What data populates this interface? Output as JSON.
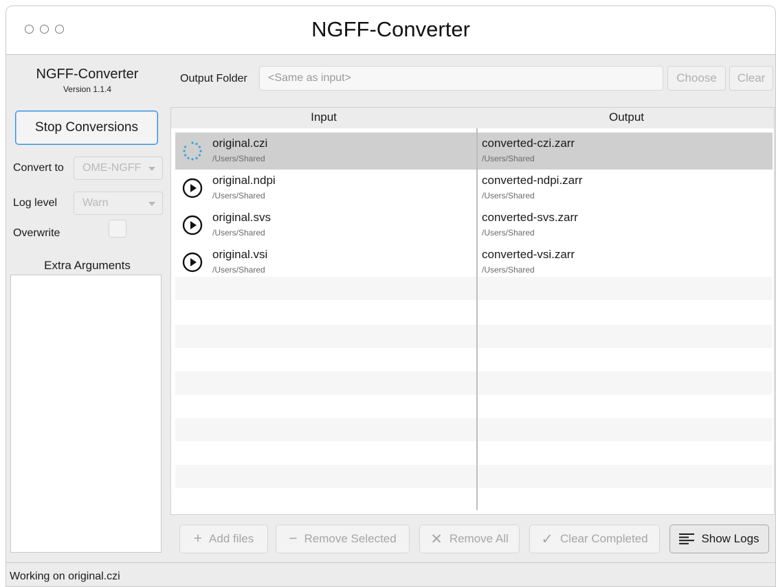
{
  "window": {
    "title": "NGFF-Converter"
  },
  "sidebar": {
    "app_name": "NGFF-Converter",
    "version": "Version 1.1.4",
    "stop_button": "Stop Conversions",
    "convert_to_label": "Convert to",
    "convert_to_value": "OME-NGFF",
    "log_level_label": "Log level",
    "log_level_value": "Warn",
    "overwrite_label": "Overwrite",
    "overwrite_checked": false,
    "extra_args_label": "Extra Arguments",
    "extra_args_value": ""
  },
  "output": {
    "label": "Output Folder",
    "placeholder": "<Same as input>",
    "choose_button": "Choose",
    "clear_button": "Clear"
  },
  "table": {
    "headers": {
      "input": "Input",
      "output": "Output"
    },
    "rows": [
      {
        "input_name": "original.czi",
        "input_path": "/Users/Shared",
        "output_name": "converted-czi.zarr",
        "output_path": "/Users/Shared",
        "status": "spinner-icon",
        "selected": true
      },
      {
        "input_name": "original.ndpi",
        "input_path": "/Users/Shared",
        "output_name": "converted-ndpi.zarr",
        "output_path": "/Users/Shared",
        "status": "play-icon",
        "selected": false
      },
      {
        "input_name": "original.svs",
        "input_path": "/Users/Shared",
        "output_name": "converted-svs.zarr",
        "output_path": "/Users/Shared",
        "status": "play-icon",
        "selected": false
      },
      {
        "input_name": "original.vsi",
        "input_path": "/Users/Shared",
        "output_name": "converted-vsi.zarr",
        "output_path": "/Users/Shared",
        "status": "play-icon",
        "selected": false
      }
    ]
  },
  "actions": {
    "add_files": {
      "label": "Add files",
      "icon": "plus-icon"
    },
    "remove_selected": {
      "label": "Remove Selected",
      "icon": "minus-icon"
    },
    "remove_all": {
      "label": "Remove All",
      "icon": "x-icon"
    },
    "clear_completed": {
      "label": "Clear Completed",
      "icon": "check-icon"
    },
    "show_logs": {
      "label": "Show Logs",
      "icon": "lines-icon"
    }
  },
  "status_bar": {
    "text": "Working on original.czi"
  },
  "colors": {
    "accent": "#2f8ee0",
    "selected_row": "#cfcfcf",
    "spinner": "#3aa3d8"
  }
}
